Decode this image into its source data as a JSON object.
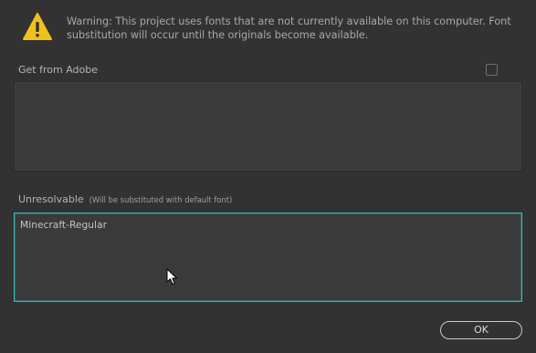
{
  "warning": {
    "icon": "warning-triangle-icon",
    "text": "Warning: This project uses fonts that are not currently available on this computer. Font substitution will occur until the originals become available."
  },
  "adobe_section": {
    "label": "Get from Adobe",
    "checked": false,
    "items": []
  },
  "unresolvable_section": {
    "label": "Unresolvable",
    "note": "(Will be substituted with default font)",
    "items": [
      "Minecraft-Regular"
    ]
  },
  "ok_label": "OK",
  "colors": {
    "background": "#323232",
    "accent": "#3fb7b6",
    "warning": "#f2c01d"
  }
}
